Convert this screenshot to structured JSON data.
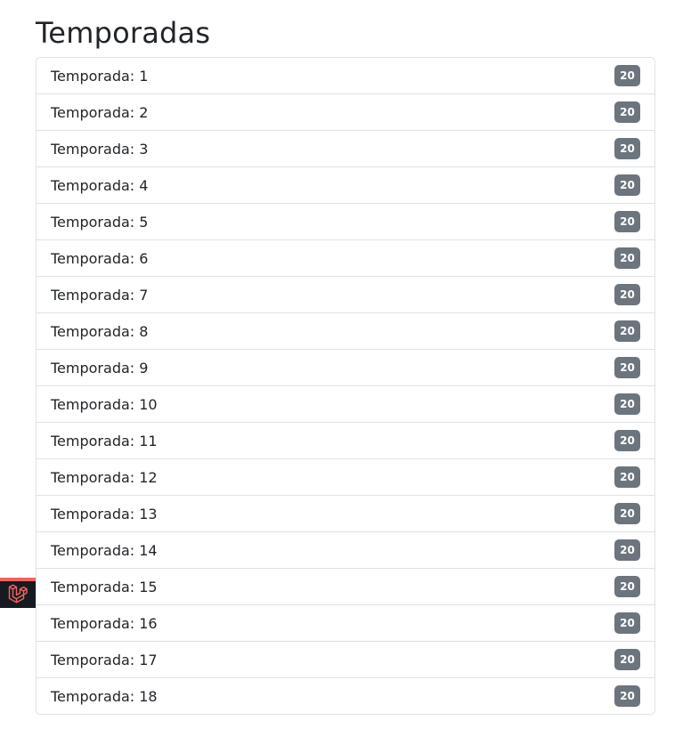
{
  "page": {
    "title": "Temporadas"
  },
  "seasons": [
    {
      "label": "Temporada: 1",
      "count": "20"
    },
    {
      "label": "Temporada: 2",
      "count": "20"
    },
    {
      "label": "Temporada: 3",
      "count": "20"
    },
    {
      "label": "Temporada: 4",
      "count": "20"
    },
    {
      "label": "Temporada: 5",
      "count": "20"
    },
    {
      "label": "Temporada: 6",
      "count": "20"
    },
    {
      "label": "Temporada: 7",
      "count": "20"
    },
    {
      "label": "Temporada: 8",
      "count": "20"
    },
    {
      "label": "Temporada: 9",
      "count": "20"
    },
    {
      "label": "Temporada: 10",
      "count": "20"
    },
    {
      "label": "Temporada: 11",
      "count": "20"
    },
    {
      "label": "Temporada: 12",
      "count": "20"
    },
    {
      "label": "Temporada: 13",
      "count": "20"
    },
    {
      "label": "Temporada: 14",
      "count": "20"
    },
    {
      "label": "Temporada: 15",
      "count": "20"
    },
    {
      "label": "Temporada: 16",
      "count": "20"
    },
    {
      "label": "Temporada: 17",
      "count": "20"
    },
    {
      "label": "Temporada: 18",
      "count": "20"
    }
  ],
  "colors": {
    "badge": "#6c757d",
    "border": "#dee2e6",
    "toolbar_bg": "#161b22",
    "toolbar_accent": "#f4645f"
  },
  "icons": {
    "toolbar": "laravel-icon"
  }
}
